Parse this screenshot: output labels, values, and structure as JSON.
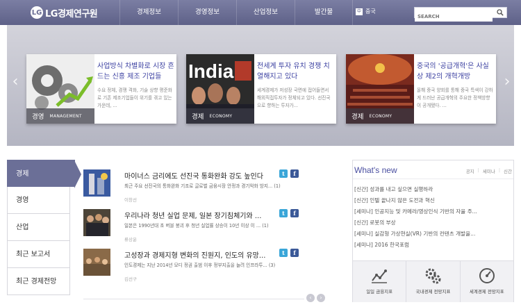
{
  "header": {
    "logo_text": "LG경제연구원",
    "logo_mark": "LG",
    "nav": [
      "경제정보",
      "경영정보",
      "산업정보",
      "발간물"
    ],
    "lang_box": "中",
    "lang_label": "중국",
    "search_placeholder": "SEARCH"
  },
  "hero": {
    "cards": [
      {
        "title": "사업방식 차별화로 시장 흔드는 신흥 제조 기업들",
        "desc": "수요 정체, 경쟁 격화, 기술 상향 평준화로 기존 제조기업들이 위기를 겪고 있는 가운데, ...",
        "cat_ko": "경영",
        "cat_en": "MANAGEMENT"
      },
      {
        "title": "전세계 투자 유치 경쟁 치열해지고 있다",
        "desc": "세계경제가 저성장 국면에 접어들면서 해외직접투자가 정체되고 있다. 선진국으로 향하는 투자가...",
        "cat_ko": "경제",
        "cat_en": "ECONOMY",
        "img_text": "India"
      },
      {
        "title": "중국의 '공급개혁'은 사실상 제2의 개혁개방",
        "desc": "올해 중국 양회를 통해 중국 특색이 강하게 드러난 공급개혁의 주요한 정책방향이 공개됐다. ...",
        "cat_ko": "경제",
        "cat_en": "ECONOMY"
      }
    ]
  },
  "tabs": [
    "경제",
    "경영",
    "산업",
    "최근 보고서",
    "최근 경제전망"
  ],
  "articles": [
    {
      "title": "마이너스 금리에도 선진국 통화완화 강도 높인다",
      "desc": "최근 주요 선진국의 통화완화 기조로 글로벌 금융시장 안정과 경기악화 방지... (1)",
      "author": "이창선"
    },
    {
      "title": "우리나라 청년 실업 문제, 일본 장기침체기와 ...",
      "desc": "일본은 1990년대 초 버블 붕괴 후 청년 실업률 상승이 10년 이상 이 ... (1)",
      "author": "류상윤"
    },
    {
      "title": "고성장과 경제지형 변화의 진원지, 인도의 유망...",
      "desc": "인도경제는 지난 2014년 모디 정권 출범 이후 정부지출을 늘려 인프라투... (3)",
      "author": "김선구"
    }
  ],
  "sns": {
    "twitter": "t",
    "facebook": "f"
  },
  "pager": {
    "prev": "‹",
    "next": "›"
  },
  "whats_new": {
    "title": "What's new",
    "filters": [
      "공지",
      "세미나",
      "신간"
    ],
    "items": [
      "[신간] 성과를 내고 싶으면 실행하라",
      "[신간] 인텔 끝나지 않은 도전과 혁신",
      "[세미나] 인공지능 및 카메라/영상인식 기반의 자율 주...",
      "[신간] 로봇의 부상",
      "[세미나] 실감형 가상현실(VR) 기반의 컨텐츠 개발을...",
      "[세미나] 2016 한국포럼"
    ],
    "quick_links": [
      "일일 금융지표",
      "국내경제 전망지표",
      "세계경제 전망지표"
    ]
  },
  "colors": {
    "header": "#6a6d94",
    "accent": "#4a4fa0",
    "tab_active": "#6b6f97"
  }
}
